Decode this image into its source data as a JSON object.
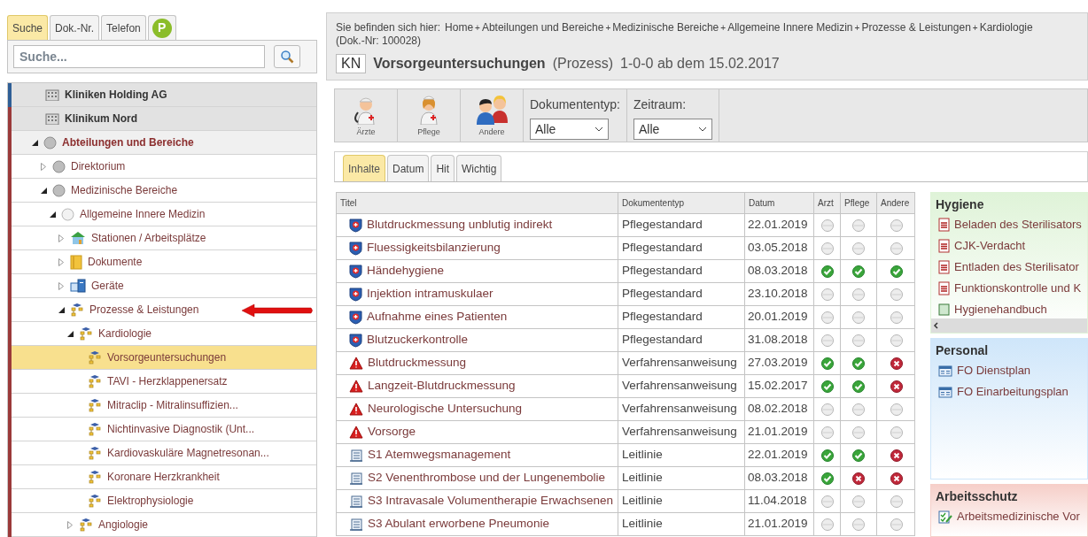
{
  "left_tabs": [
    {
      "label": "Suche",
      "kind": "text",
      "selected": true
    },
    {
      "label": "Dok.-Nr.",
      "kind": "text",
      "selected": false
    },
    {
      "label": "Telefon",
      "kind": "text",
      "selected": false
    },
    {
      "label": "P",
      "kind": "badge",
      "selected": false
    }
  ],
  "search": {
    "placeholder": "Suche..."
  },
  "tree": [
    {
      "label": "Kliniken Holding AG",
      "kind": "org",
      "color": "#2f5f96",
      "selected": false
    },
    {
      "label": "Klinikum Nord",
      "kind": "org",
      "color": "#9b3a3a",
      "selected": false
    },
    {
      "label": "Abteilungen und Bereiche",
      "kind": "area",
      "expanded": true,
      "selected": false,
      "children": [
        {
          "label": "Direktorium",
          "kind": "area",
          "expanded": false,
          "selected": false
        },
        {
          "label": "Medizinische Bereiche",
          "kind": "area",
          "expanded": true,
          "selected": false,
          "children": [
            {
              "label": "Allgemeine Innere Medizin",
              "kind": "area-light",
              "expanded": true,
              "selected": false,
              "children": [
                {
                  "label": "Stationen / Arbeitsplätze",
                  "kind": "station",
                  "expanded": false,
                  "selected": false
                },
                {
                  "label": "Dokumente",
                  "kind": "folder",
                  "expanded": false,
                  "selected": false
                },
                {
                  "label": "Geräte",
                  "kind": "device",
                  "expanded": false,
                  "selected": false
                },
                {
                  "label": "Prozesse & Leistungen",
                  "kind": "process",
                  "expanded": true,
                  "selected": false,
                  "pointer": true,
                  "children": [
                    {
                      "label": "Kardiologie",
                      "kind": "process",
                      "expanded": true,
                      "selected": false,
                      "children": [
                        {
                          "label": "Vorsorgeuntersuchungen",
                          "kind": "process",
                          "selected": true
                        },
                        {
                          "label": "TAVI - Herzklappenersatz",
                          "kind": "process",
                          "selected": false
                        },
                        {
                          "label": "Mitraclip - Mitralinsuffizien...",
                          "kind": "process",
                          "selected": false
                        },
                        {
                          "label": "Nichtinvasive Diagnostik (Unt...",
                          "kind": "process",
                          "selected": false
                        },
                        {
                          "label": "Kardiovaskuläre Magnetresonan...",
                          "kind": "process",
                          "selected": false
                        },
                        {
                          "label": "Koronare Herzkrankheit",
                          "kind": "process",
                          "selected": false
                        },
                        {
                          "label": "Elektrophysiologie",
                          "kind": "process",
                          "selected": false
                        }
                      ]
                    },
                    {
                      "label": "Angiologie",
                      "kind": "process",
                      "expanded": false,
                      "selected": false
                    }
                  ]
                }
              ]
            }
          ]
        }
      ]
    }
  ],
  "breadcrumb": {
    "prefix": "Sie befinden sich hier:",
    "items": [
      "Home",
      "Abteilungen und Bereiche",
      "Medizinische Bereiche",
      "Allgemeine Innere Medizin",
      "Prozesse & Leistungen",
      "Kardiologie"
    ],
    "separator": "+",
    "doc_number": "(Dok.-Nr: 100028)"
  },
  "header": {
    "badge": "KN",
    "title": "Vorsorgeuntersuchungen",
    "type": "(Prozess)",
    "version": "1-0-0 ab dem 15.02.2017"
  },
  "toolbar": {
    "roles": [
      {
        "label": "Ärzte",
        "kind": "doctor"
      },
      {
        "label": "Pflege",
        "kind": "nurse"
      },
      {
        "label": "Andere",
        "kind": "others"
      }
    ],
    "filters": [
      {
        "label": "Dokumententyp:",
        "value": "Alle"
      },
      {
        "label": "Zeitraum:",
        "value": "Alle"
      }
    ]
  },
  "content_tabs": [
    {
      "label": "Inhalte",
      "selected": true
    },
    {
      "label": "Datum",
      "selected": false
    },
    {
      "label": "Hit",
      "selected": false
    },
    {
      "label": "Wichtig",
      "selected": false
    }
  ],
  "table": {
    "columns": [
      "Titel",
      "Dokumententyp",
      "Datum",
      "Arzt",
      "Pflege",
      "Andere"
    ],
    "rows": [
      {
        "kind": "standard",
        "title": "Blutdruckmessung unblutig indirekt",
        "type": "Pflegestandard",
        "date": "22.01.2019",
        "arzt": {
          "kind": "none"
        },
        "pflege": {
          "kind": "none"
        },
        "andere": {
          "kind": "none"
        }
      },
      {
        "kind": "standard",
        "title": "Fluessigkeitsbilanzierung",
        "type": "Pflegestandard",
        "date": "03.05.2018",
        "arzt": {
          "kind": "none"
        },
        "pflege": {
          "kind": "none"
        },
        "andere": {
          "kind": "none"
        }
      },
      {
        "kind": "standard",
        "title": "Händehygiene",
        "type": "Pflegestandard",
        "date": "08.03.2018",
        "arzt": {
          "kind": "yes"
        },
        "pflege": {
          "kind": "yes"
        },
        "andere": {
          "kind": "yes"
        }
      },
      {
        "kind": "standard",
        "title": "Injektion intramuskulaer",
        "type": "Pflegestandard",
        "date": "23.10.2018",
        "arzt": {
          "kind": "none"
        },
        "pflege": {
          "kind": "none"
        },
        "andere": {
          "kind": "none"
        }
      },
      {
        "kind": "standard",
        "title": "Aufnahme eines Patienten",
        "type": "Pflegestandard",
        "date": "20.01.2019",
        "arzt": {
          "kind": "none"
        },
        "pflege": {
          "kind": "none"
        },
        "andere": {
          "kind": "none"
        }
      },
      {
        "kind": "standard",
        "title": "Blutzuckerkontrolle",
        "type": "Pflegestandard",
        "date": "31.08.2018",
        "arzt": {
          "kind": "none"
        },
        "pflege": {
          "kind": "none"
        },
        "andere": {
          "kind": "none"
        }
      },
      {
        "kind": "warning",
        "title": "Blutdruckmessung",
        "type": "Verfahrensanweisung",
        "date": "27.03.2019",
        "arzt": {
          "kind": "yes"
        },
        "pflege": {
          "kind": "yes"
        },
        "andere": {
          "kind": "no"
        }
      },
      {
        "kind": "warning",
        "title": "Langzeit-Blutdruckmessung",
        "type": "Verfahrensanweisung",
        "date": "15.02.2017",
        "arzt": {
          "kind": "yes"
        },
        "pflege": {
          "kind": "yes"
        },
        "andere": {
          "kind": "no"
        }
      },
      {
        "kind": "warning",
        "title": "Neurologische Untersuchung",
        "type": "Verfahrensanweisung",
        "date": "08.02.2018",
        "arzt": {
          "kind": "none"
        },
        "pflege": {
          "kind": "none"
        },
        "andere": {
          "kind": "none"
        }
      },
      {
        "kind": "warning",
        "title": "Vorsorge",
        "type": "Verfahrensanweisung",
        "date": "21.01.2019",
        "arzt": {
          "kind": "none"
        },
        "pflege": {
          "kind": "none"
        },
        "andere": {
          "kind": "none"
        }
      },
      {
        "kind": "guideline",
        "title": "S1 Atemwegsmanagement",
        "type": "Leitlinie",
        "date": "22.01.2019",
        "arzt": {
          "kind": "yes"
        },
        "pflege": {
          "kind": "yes"
        },
        "andere": {
          "kind": "no"
        }
      },
      {
        "kind": "guideline",
        "title": "S2 Venenthrombose und der Lungenembolie",
        "type": "Leitlinie",
        "date": "08.03.2018",
        "arzt": {
          "kind": "yes"
        },
        "pflege": {
          "kind": "no"
        },
        "andere": {
          "kind": "no"
        }
      },
      {
        "kind": "guideline",
        "title": "S3 Intravasale Volumentherapie Erwachsenen",
        "type": "Leitlinie",
        "date": "11.04.2018",
        "arzt": {
          "kind": "none"
        },
        "pflege": {
          "kind": "none"
        },
        "andere": {
          "kind": "none"
        }
      },
      {
        "kind": "guideline",
        "title": "S3 Abulant erworbene Pneumonie",
        "type": "Leitlinie",
        "date": "21.01.2019",
        "arzt": {
          "kind": "none"
        },
        "pflege": {
          "kind": "none"
        },
        "andere": {
          "kind": "none"
        }
      }
    ]
  },
  "side_panels": [
    {
      "title": "Hygiene",
      "color": "#dff3d8",
      "scrollbar": true,
      "items": [
        {
          "label": "Beladen des Sterilisators",
          "kind": "document"
        },
        {
          "label": "CJK-Verdacht",
          "kind": "document"
        },
        {
          "label": "Entladen des Sterilisator",
          "kind": "document"
        },
        {
          "label": "Funktionskontrolle und K",
          "kind": "document"
        },
        {
          "label": "Hygienehandbuch",
          "kind": "handbook"
        }
      ]
    },
    {
      "title": "Personal",
      "color": "#cfe6fa",
      "scrollbar": false,
      "items": [
        {
          "label": "FO Dienstplan",
          "kind": "form"
        },
        {
          "label": "FO Einarbeitungsplan",
          "kind": "form"
        }
      ]
    },
    {
      "title": "Arbeitsschutz",
      "color": "#f6cfc9",
      "scrollbar": false,
      "items": [
        {
          "label": "Arbeitsmedizinische Vor",
          "kind": "checklist"
        }
      ]
    }
  ]
}
